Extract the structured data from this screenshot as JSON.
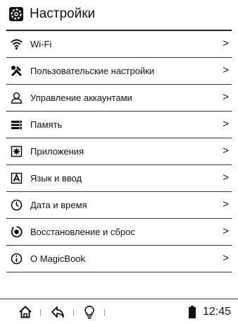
{
  "header": {
    "title": "Настройки",
    "icon": "settings-gear-icon"
  },
  "items": [
    {
      "label": "Wi-Fi",
      "icon": "wifi-icon",
      "chevron": ">"
    },
    {
      "label": "Пользовательские настройки",
      "icon": "tools-icon",
      "chevron": ">"
    },
    {
      "label": "Управление аккаунтами",
      "icon": "user-icon",
      "chevron": ">"
    },
    {
      "label": "Память",
      "icon": "storage-icon",
      "chevron": ">"
    },
    {
      "label": "Приложения",
      "icon": "apps-icon",
      "chevron": ">"
    },
    {
      "label": "Язык и ввод",
      "icon": "language-icon",
      "chevron": ">"
    },
    {
      "label": "Дата и время",
      "icon": "clock-icon",
      "chevron": ">"
    },
    {
      "label": "Восстановление и сброс",
      "icon": "reset-icon",
      "chevron": ">"
    },
    {
      "label": "O MagicBook",
      "icon": "info-icon",
      "chevron": ">"
    }
  ],
  "statusbar": {
    "time": "12:45",
    "icons": [
      "home-icon",
      "back-icon",
      "light-bulb-icon",
      "battery-icon"
    ]
  }
}
